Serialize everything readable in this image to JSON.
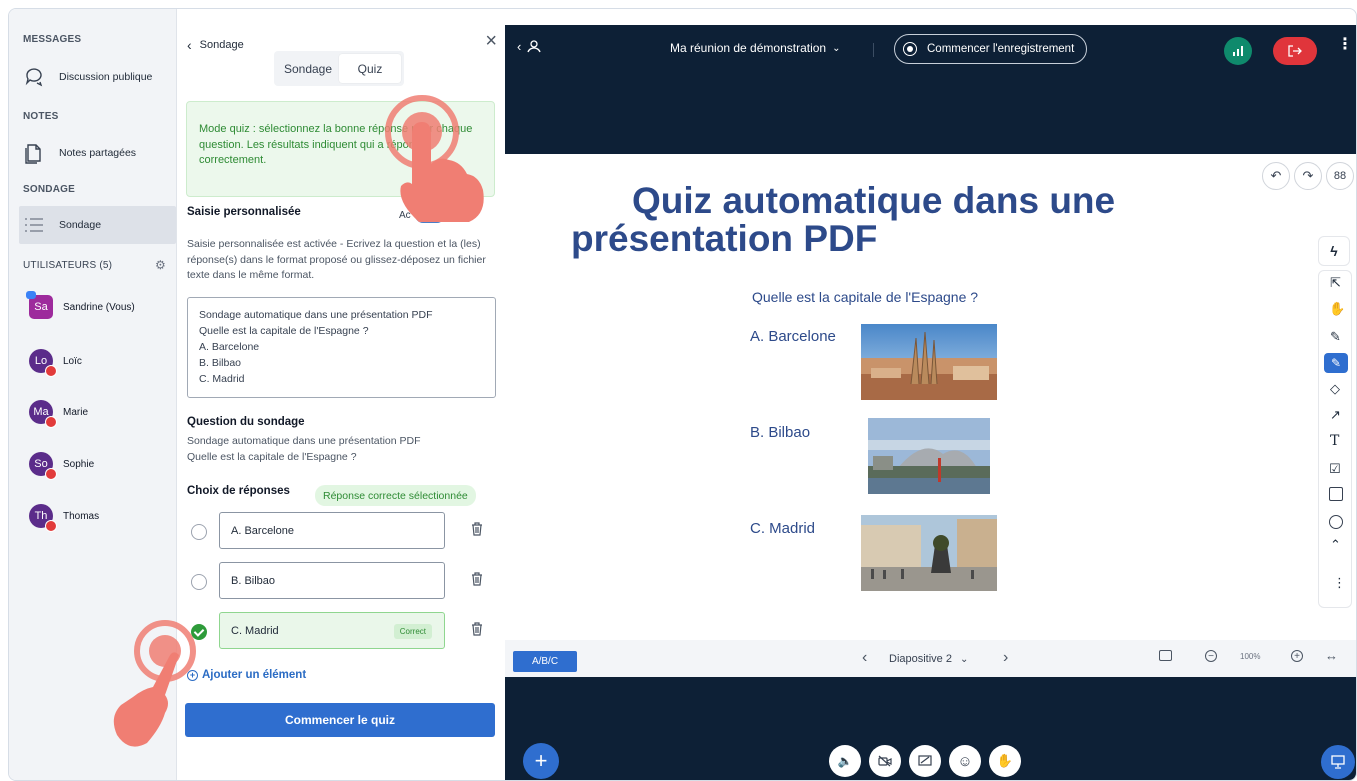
{
  "sidebar": {
    "messages_title": "MESSAGES",
    "public_chat": "Discussion publique",
    "notes_title": "NOTES",
    "shared_notes": "Notes partagées",
    "poll_title": "SONDAGE",
    "poll_item": "Sondage",
    "users_title": "UTILISATEURS (5)",
    "users": [
      {
        "initials": "Sa",
        "name": "Sandrine (Vous)"
      },
      {
        "initials": "Lo",
        "name": "Loïc"
      },
      {
        "initials": "Ma",
        "name": "Marie"
      },
      {
        "initials": "So",
        "name": "Sophie"
      },
      {
        "initials": "Th",
        "name": "Thomas"
      }
    ]
  },
  "panel": {
    "back_label": "Sondage",
    "tabs": [
      "Sondage",
      "Quiz"
    ],
    "info": "Mode quiz : sélectionnez la bonne réponse pour chaque question. Les résultats indiquent qui a répondu correctement.",
    "custom_label": "Saisie personnalisée",
    "toggle_label": "Ac",
    "custom_help": "Saisie personnalisée est activée - Ecrivez la question et la (les) réponse(s) dans le format proposé ou glissez-déposez un fichier texte dans le même format.",
    "textarea_lines": [
      "Sondage automatique dans une présentation PDF",
      "Quelle est la capitale de l'Espagne ?",
      "A. Barcelone",
      "B. Bilbao",
      "C. Madrid"
    ],
    "question_label": "Question du sondage",
    "question_lines": [
      "Sondage automatique dans une présentation PDF",
      "Quelle est la capitale de l'Espagne ?"
    ],
    "choices_label": "Choix de réponses",
    "correct_pill": "Réponse correcte sélectionnée",
    "options": [
      "A. Barcelone",
      "B. Bilbao",
      "C. Madrid"
    ],
    "correct_badge": "Correct",
    "add_label": "Ajouter un élément",
    "start_label": "Commencer le quiz"
  },
  "meeting": {
    "title": "Ma réunion de démonstration",
    "record_label": "Commencer l'enregistrement",
    "slide_title_1": "Quiz  automatique dans une",
    "slide_title_2": "présentation PDF",
    "slide_question": "Quelle est la capitale de l'Espagne ?",
    "slide_options": [
      "A.  Barcelone",
      "B. Bilbao",
      "C. Madrid"
    ],
    "abc_label": "A/B/C",
    "slide_label": "Diapositive 2",
    "zoom": "100%"
  },
  "colors": {
    "accent": "#2f6ecf",
    "green": "#2e8b34",
    "dark": "#0d2036",
    "slide_text": "#2d4a8a",
    "leave": "#e0353b"
  }
}
